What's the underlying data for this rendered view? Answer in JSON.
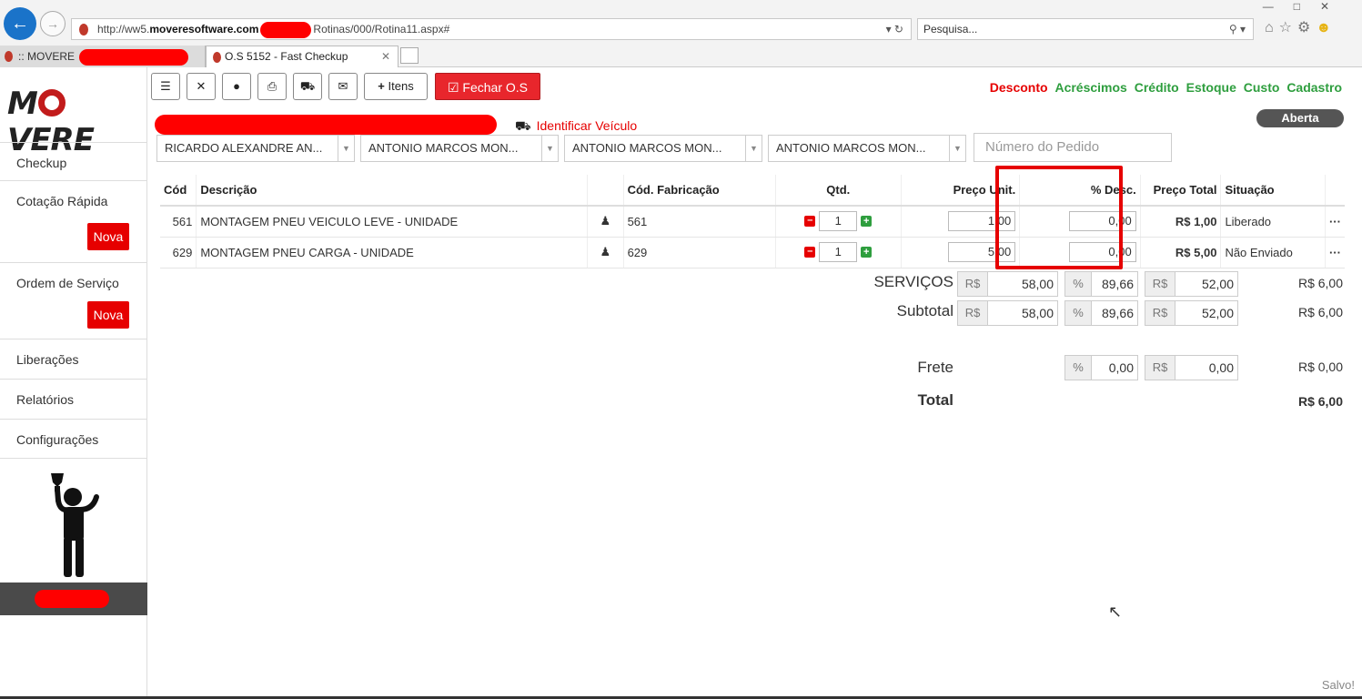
{
  "browser": {
    "url_prefix": "http://ww5.",
    "url_host": "moveresoftware.com",
    "url_suffix": "Rotinas/000/Rotina11.aspx#",
    "search_placeholder": "Pesquisa...",
    "tabs": [
      {
        "label": ":: MOVERE"
      },
      {
        "label": "O.S 5152 - Fast Checkup"
      }
    ]
  },
  "sidebar": {
    "logo_left": "M",
    "logo_right": "VERE",
    "items": [
      {
        "label": "Checkup"
      },
      {
        "label": "Cotação Rápida",
        "badge": "Nova"
      },
      {
        "label": "Ordem de Serviço",
        "badge": "Nova"
      },
      {
        "label": "Liberações"
      },
      {
        "label": "Relatórios"
      },
      {
        "label": "Configurações"
      }
    ]
  },
  "toolbar": {
    "itens_label": "Itens",
    "fechar_label": "Fechar O.S"
  },
  "top_links": {
    "desconto": "Desconto",
    "acrescimos": "Acréscimos",
    "credito": "Crédito",
    "estoque": "Estoque",
    "custo": "Custo",
    "cadastro": "Cadastro"
  },
  "status_badge": "Aberta",
  "identificar": "Identificar Veículo",
  "selects": [
    "RICARDO ALEXANDRE AN...",
    "ANTONIO MARCOS MON...",
    "ANTONIO MARCOS MON...",
    "ANTONIO MARCOS MON..."
  ],
  "pedido_placeholder": "Número do Pedido",
  "table": {
    "headers": {
      "cod": "Cód",
      "descricao": "Descrição",
      "cod_fab": "Cód. Fabricação",
      "qtd": "Qtd.",
      "preco_unit": "Preço Unit.",
      "desc": "% Desc.",
      "preco_total": "Preço Total",
      "situacao": "Situação"
    },
    "rows": [
      {
        "cod": "561",
        "descricao": "MONTAGEM PNEU VEICULO LEVE - UNIDADE",
        "cod_fab": "561",
        "qtd": "1",
        "preco_unit": "1,00",
        "desc": "0,00",
        "preco_total": "R$ 1,00",
        "situacao": "Liberado"
      },
      {
        "cod": "629",
        "descricao": "MONTAGEM PNEU CARGA - UNIDADE",
        "cod_fab": "629",
        "qtd": "1",
        "preco_unit": "5,00",
        "desc": "0,00",
        "preco_total": "R$ 5,00",
        "situacao": "Não Enviado"
      }
    ]
  },
  "totals": {
    "servicos": {
      "label": "SERVIÇOS",
      "cur": "R$",
      "bruto": "58,00",
      "pct_sym": "%",
      "pct": "89,66",
      "cur2": "R$",
      "desconto": "52,00",
      "final": "R$ 6,00"
    },
    "subtotal": {
      "label": "Subtotal",
      "cur": "R$",
      "bruto": "58,00",
      "pct_sym": "%",
      "pct": "89,66",
      "cur2": "R$",
      "desconto": "52,00",
      "final": "R$ 6,00"
    },
    "frete": {
      "label": "Frete",
      "pct_sym": "%",
      "pct": "0,00",
      "cur2": "R$",
      "valor": "0,00",
      "final": "R$ 0,00"
    },
    "total": {
      "label": "Total",
      "final": "R$ 6,00"
    }
  },
  "salvo": "Salvo!",
  "colors": {
    "accent_red": "#e60000",
    "link_green": "#2e9e3e",
    "warn_orange": "#f0a500"
  }
}
